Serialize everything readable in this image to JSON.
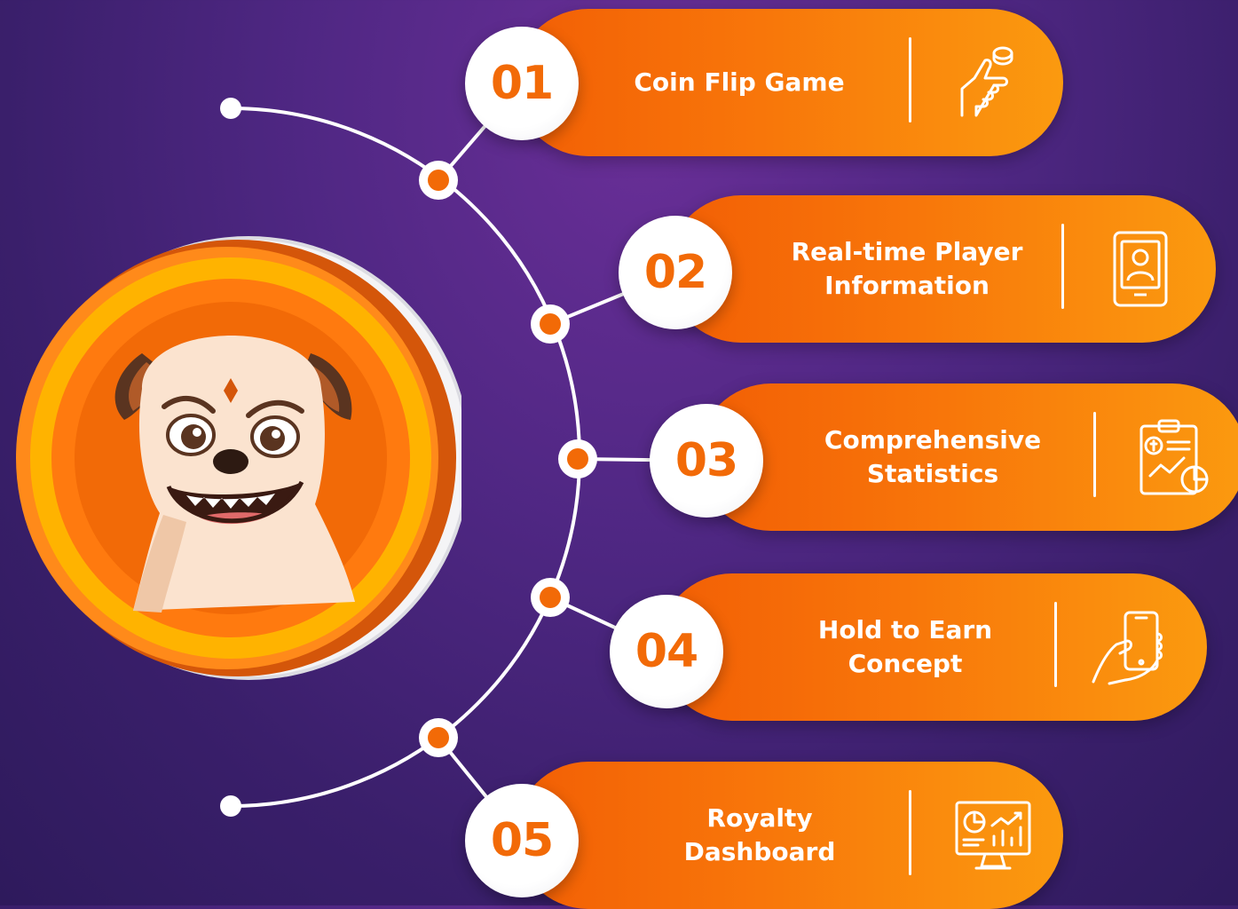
{
  "steps": [
    {
      "number": "01",
      "lines": [
        "Coin Flip Game"
      ],
      "icon": "coin-flip-hand-icon"
    },
    {
      "number": "02",
      "lines": [
        "Real-time Player",
        "Information"
      ],
      "icon": "player-profile-tablet-icon"
    },
    {
      "number": "03",
      "lines": [
        "Comprehensive",
        "Statistics"
      ],
      "icon": "statistics-clipboard-icon"
    },
    {
      "number": "04",
      "lines": [
        "Hold to Earn",
        "Concept"
      ],
      "icon": "hand-holding-phone-icon"
    },
    {
      "number": "05",
      "lines": [
        "Royalty",
        "Dashboard"
      ],
      "icon": "dashboard-monitor-icon"
    }
  ],
  "mascot": {
    "icon": "bulldog-coin-mascot-icon"
  },
  "colors": {
    "background": "#4f2783",
    "orange": "#f26a07",
    "orange_light": "#fb9a0f",
    "coin_gold": "#ffb300",
    "white": "#ffffff"
  }
}
